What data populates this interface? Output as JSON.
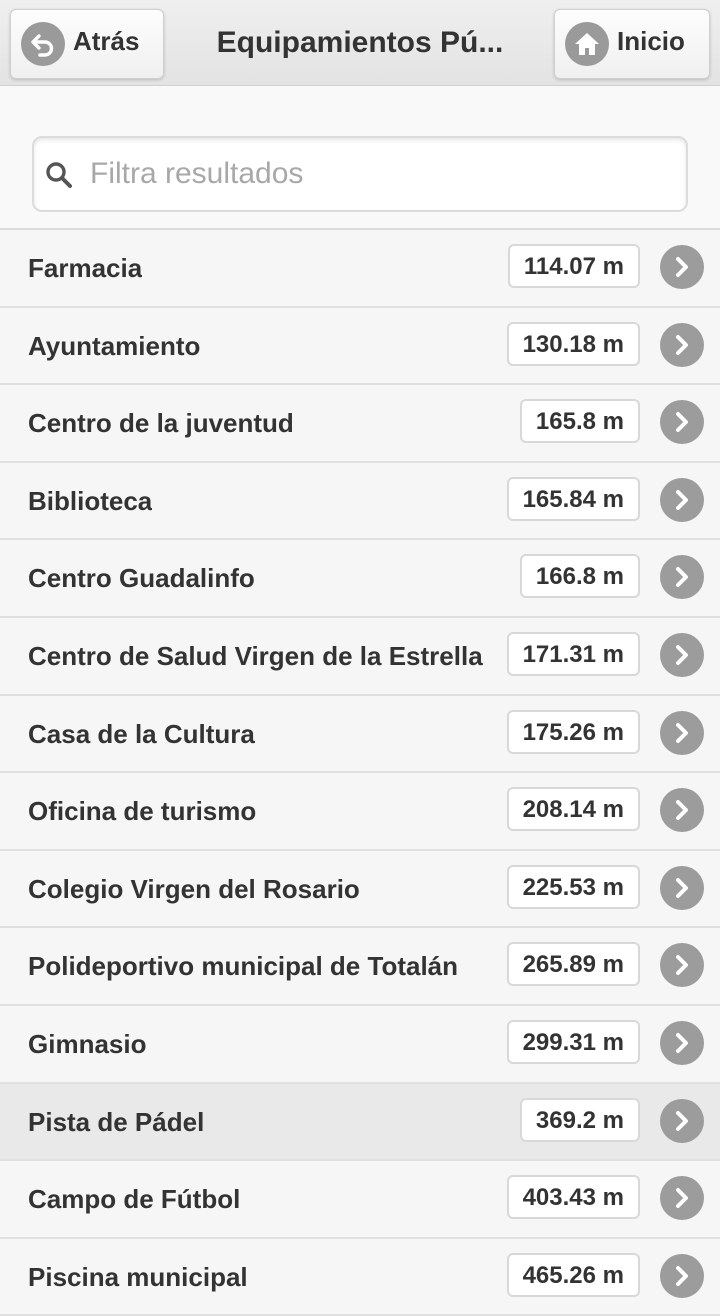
{
  "header": {
    "back_label": "Atrás",
    "title": "Equipamientos Pú...",
    "home_label": "Inicio"
  },
  "search": {
    "placeholder": "Filtra resultados",
    "value": ""
  },
  "items": [
    {
      "name": "Farmacia",
      "distance": "114.07 m"
    },
    {
      "name": "Ayuntamiento",
      "distance": "130.18 m"
    },
    {
      "name": "Centro de la juventud",
      "distance": "165.8 m"
    },
    {
      "name": "Biblioteca",
      "distance": "165.84 m"
    },
    {
      "name": "Centro Guadalinfo",
      "distance": "166.8 m"
    },
    {
      "name": "Centro de Salud Virgen de la Estrella",
      "distance": "171.31 m"
    },
    {
      "name": "Casa de la Cultura",
      "distance": "175.26 m"
    },
    {
      "name": "Oficina de turismo",
      "distance": "208.14 m"
    },
    {
      "name": "Colegio Virgen del Rosario",
      "distance": "225.53 m"
    },
    {
      "name": "Polideportivo municipal de Totalán",
      "distance": "265.89 m"
    },
    {
      "name": "Gimnasio",
      "distance": "299.31 m"
    },
    {
      "name": "Pista de Pádel",
      "distance": "369.2 m"
    },
    {
      "name": "Campo de Fútbol",
      "distance": "403.43 m"
    },
    {
      "name": "Piscina municipal",
      "distance": "465.26 m"
    }
  ],
  "icons": {
    "back": "back-arrow-icon",
    "home": "home-icon",
    "search": "search-icon",
    "row_arrow": "chevron-right-icon"
  },
  "colors": {
    "header_bg": "#e8e8e8",
    "icon_circle": "#9c9c9c",
    "row_bg": "#f6f6f6",
    "row_highlight": "#e9e9e9",
    "text": "#333333"
  }
}
